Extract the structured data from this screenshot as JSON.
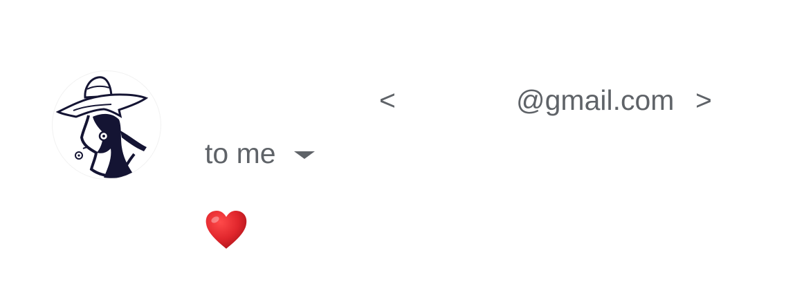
{
  "sender": {
    "name": "",
    "email_open": "<",
    "email_address": "@gmail.com",
    "email_close": ">"
  },
  "recipient": {
    "label": "to me"
  },
  "message": {
    "body": "❤️"
  },
  "icons": {
    "avatar": "avatar-icon",
    "recipient_details": "caret-down-icon",
    "heart": "heart-icon"
  },
  "colors": {
    "secondary_text": "#5f6368",
    "heart": "#e0262c",
    "avatar_ink": "#141433"
  }
}
